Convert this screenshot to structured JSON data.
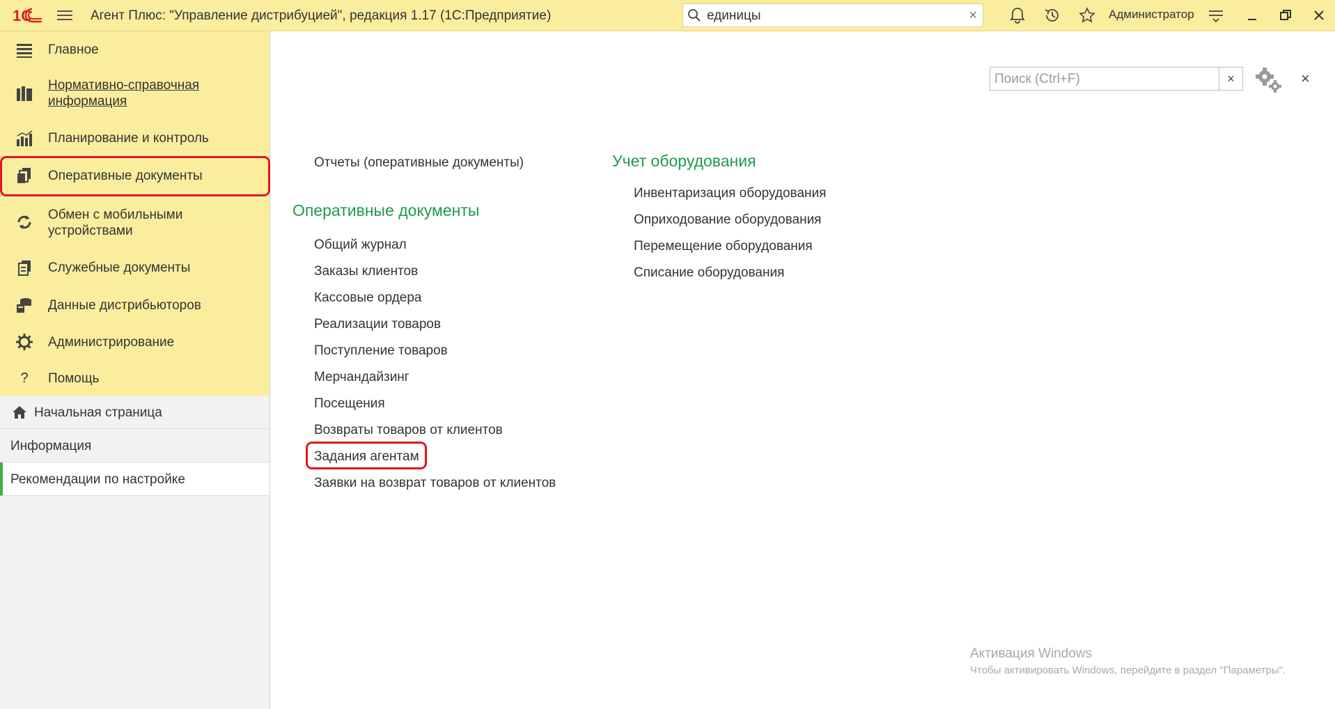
{
  "titlebar": {
    "logo_text": "1С",
    "app_title": "Агент Плюс: \"Управление дистрибуцией\", редакция 1.17  (1С:Предприятие)",
    "search_value": "единицы",
    "clear_label": "×",
    "user_name": "Администратор"
  },
  "sections": [
    {
      "label": "Главное",
      "icon": "list-icon"
    },
    {
      "label": "Нормативно-справочная информация",
      "icon": "books-icon",
      "underlined": true
    },
    {
      "label": "Планирование и контроль",
      "icon": "bar-chart-icon"
    },
    {
      "label": "Оперативные документы",
      "icon": "documents-icon",
      "highlighted": true
    },
    {
      "label": "Обмен с мобильными устройствами",
      "icon": "sync-icon"
    },
    {
      "label": "Служебные документы",
      "icon": "service-docs-icon"
    },
    {
      "label": "Данные дистрибьюторов",
      "icon": "distributor-icon"
    },
    {
      "label": "Администрирование",
      "icon": "gear-icon"
    },
    {
      "label": "Помощь",
      "icon": "help-icon"
    }
  ],
  "nav": {
    "home_label": "Начальная страница",
    "info_label": "Информация",
    "recommendations_label": "Рекомендации по настройке"
  },
  "main": {
    "search_placeholder": "Поиск (Ctrl+F)",
    "search_clear": "×",
    "close_label": "×",
    "reports_link": "Отчеты (оперативные документы)",
    "group_docs_title": "Оперативные документы",
    "docs": [
      "Общий журнал",
      "Заказы клиентов",
      "Кассовые ордера",
      "Реализации товаров",
      "Поступление товаров",
      "Мерчандайзинг",
      "Посещения",
      "Возвраты товаров от клиентов",
      "Задания агентам",
      "Заявки на возврат товаров от клиентов"
    ],
    "group_equipment_title": "Учет оборудования",
    "equipment": [
      "Инвентаризация оборудования",
      "Оприходование оборудования",
      "Перемещение оборудования",
      "Списание оборудования"
    ]
  },
  "activation": {
    "title": "Активация Windows",
    "subtitle": "Чтобы активировать Windows, перейдите в раздел \"Параметры\"."
  },
  "colors": {
    "panel_yellow": "#fbed9e",
    "group_green": "#1e9b4a",
    "highlight_red": "#e0171d",
    "active_green": "#3fae49"
  }
}
